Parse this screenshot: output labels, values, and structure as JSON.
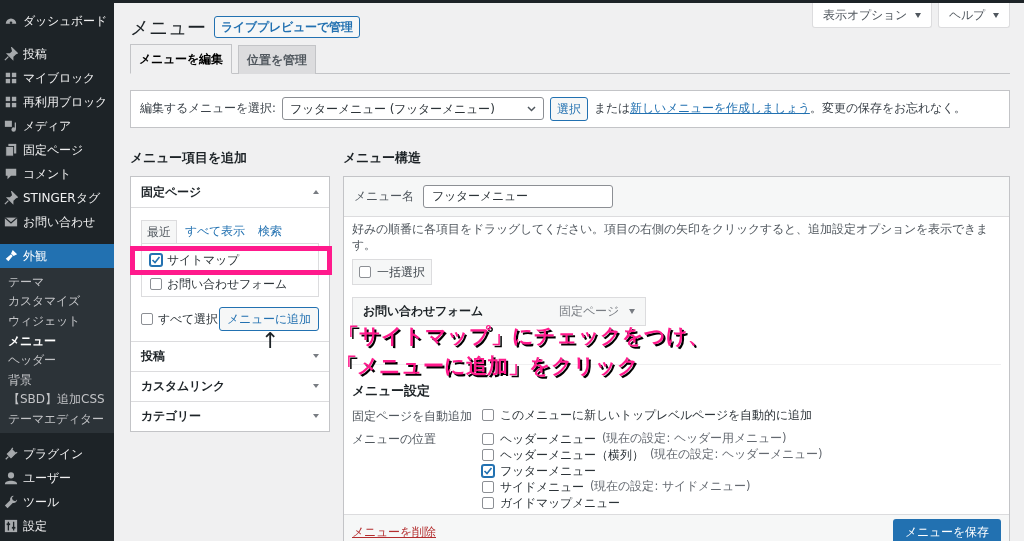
{
  "sidebar": {
    "items": [
      {
        "label": "ダッシュボード",
        "selected": false
      },
      {
        "label": "投稿",
        "selected": false
      },
      {
        "label": "マイブロック",
        "selected": false
      },
      {
        "label": "再利用ブロック",
        "selected": false
      },
      {
        "label": "メディア",
        "selected": false
      },
      {
        "label": "固定ページ",
        "selected": false
      },
      {
        "label": "コメント",
        "selected": false
      },
      {
        "label": "STINGERタグ",
        "selected": false
      },
      {
        "label": "お問い合わせ",
        "selected": false
      },
      {
        "label": "外観",
        "selected": true,
        "children": [
          {
            "label": "テーマ",
            "selected": false
          },
          {
            "label": "カスタマイズ",
            "selected": false
          },
          {
            "label": "ウィジェット",
            "selected": false
          },
          {
            "label": "メニュー",
            "selected": true
          },
          {
            "label": "ヘッダー",
            "selected": false
          },
          {
            "label": "背景",
            "selected": false
          },
          {
            "label": "【SBD】追加CSS",
            "selected": false
          },
          {
            "label": "テーマエディター",
            "selected": false
          }
        ]
      },
      {
        "label": "プラグイン",
        "selected": false
      },
      {
        "label": "ユーザー",
        "selected": false
      },
      {
        "label": "ツール",
        "selected": false
      },
      {
        "label": "設定",
        "selected": false
      }
    ]
  },
  "page": {
    "title": "メニュー",
    "title_action": "ライブプレビューで管理",
    "screen_buttons": [
      "表示オプション",
      "ヘルプ"
    ]
  },
  "tabs": [
    {
      "label": "メニューを編集",
      "selected": true
    },
    {
      "label": "位置を管理",
      "selected": false
    }
  ],
  "menu_select": {
    "label": "編集するメニューを選択:",
    "value": "フッターメニュー (フッターメニュー)",
    "button": "選択",
    "text_before": "または",
    "link": "新しいメニューを作成しましょう",
    "text_after": "。変更の保存をお忘れなく。"
  },
  "add_items": {
    "heading": "メニュー項目を追加",
    "sections": [
      {
        "title": "固定ページ",
        "expanded": true,
        "subtabs": [
          {
            "label": "最近",
            "selected": true
          },
          {
            "label": "すべて表示",
            "selected": false
          },
          {
            "label": "検索",
            "selected": false
          }
        ],
        "items": [
          {
            "label": "サイトマップ",
            "checked": true
          },
          {
            "label": "お問い合わせフォーム",
            "checked": false
          }
        ],
        "select_all": {
          "label": "すべて選択",
          "checked": false
        },
        "add_button": "メニューに追加"
      },
      {
        "title": "投稿",
        "expanded": false
      },
      {
        "title": "カスタムリンク",
        "expanded": false
      },
      {
        "title": "カテゴリー",
        "expanded": false
      }
    ]
  },
  "structure": {
    "heading": "メニュー構造",
    "name_label": "メニュー名",
    "name_value": "フッターメニュー",
    "instructions": "好みの順番に各項目をドラッグしてください。項目の右側の矢印をクリックすると、追加設定オプションを表示できます。",
    "bulk_select": {
      "label": "一括選択",
      "checked": false
    },
    "items": [
      {
        "title": "お問い合わせフォーム",
        "type": "固定ページ"
      }
    ],
    "settings": {
      "heading": "メニュー設定",
      "rows": [
        {
          "label": "固定ページを自動追加",
          "options": [
            {
              "label": "このメニューに新しいトップレベルページを自動的に追加",
              "checked": false
            }
          ]
        },
        {
          "label": "メニューの位置",
          "options": [
            {
              "label": "ヘッダーメニュー",
              "note": "(現在の設定: ヘッダー用メニュー)",
              "checked": false
            },
            {
              "label": "ヘッダーメニュー（横列）",
              "note": "(現在の設定: ヘッダーメニュー)",
              "checked": false
            },
            {
              "label": "フッターメニュー",
              "checked": true
            },
            {
              "label": "サイドメニュー",
              "note": "(現在の設定: サイドメニュー)",
              "checked": false
            },
            {
              "label": "ガイドマップメニュー",
              "checked": false
            }
          ]
        }
      ]
    },
    "delete_link": "メニューを削除",
    "save_button": "メニューを保存"
  },
  "annotation": {
    "arrow": "↑",
    "lines": [
      "「サイトマップ」にチェックをつけ、",
      "「メニューに追加」をクリック"
    ]
  }
}
